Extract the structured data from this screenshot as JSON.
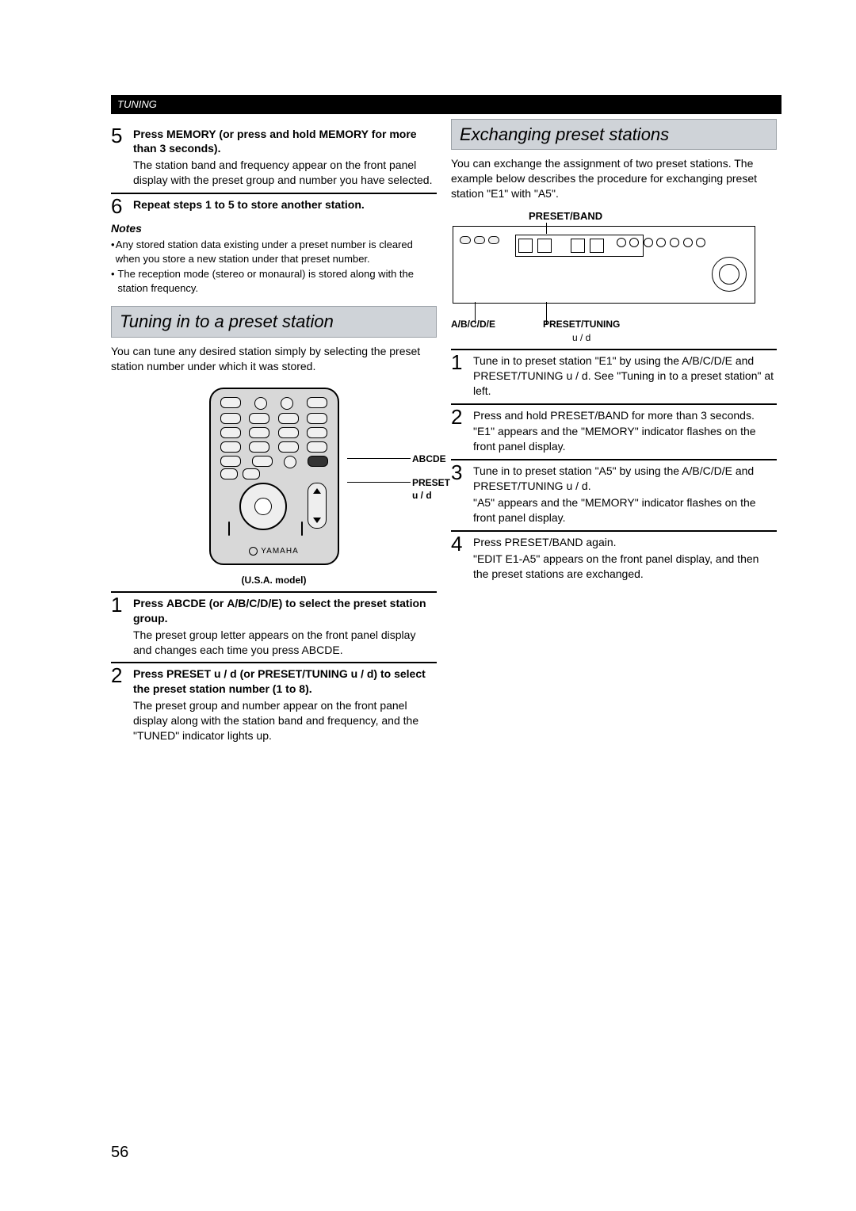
{
  "header_bar": "TUNING",
  "page_number": "56",
  "left": {
    "step5": {
      "num": "5",
      "title_html": "Press <b>MEMORY</b> (or press and hold <b>MEMORY</b> for more than 3 seconds).",
      "expl": "The station band and frequency appear on the front panel display with the preset group and number you have selected."
    },
    "step6": {
      "num": "6",
      "title": "Repeat steps 1 to 5 to store another station."
    },
    "notes_head": "Notes",
    "note1": "Any stored station data existing under a preset number is cleared when you store a new station under that preset number.",
    "note2": "The reception mode (stereo or monaural) is stored along with the station frequency.",
    "tuning_section_title": "Tuning in to a preset station",
    "tuning_intro": "You can tune any desired station simply by selecting the preset station number under which it was stored.",
    "remote": {
      "abcde": "ABCDE",
      "preset": "PRESET u / d",
      "brand": "YAMAHA",
      "usa": "(U.S.A. model)"
    },
    "step1": {
      "num": "1",
      "title_html": "Press <b>ABCDE</b> (or <b>A/B/C/D/E</b>) to select the preset station group.",
      "expl": "The preset group letter appears on the front panel display and changes each time you press ABCDE."
    },
    "step2": {
      "num": "2",
      "title_html": "Press <b>PRESET</b> u / d (or <b>PRESET/TUNING</b> u / d) to select the preset station number (1 to 8).",
      "expl": "The preset group and number appear on the front panel display along with the station band and frequency, and the \"TUNED\" indicator lights up."
    }
  },
  "right": {
    "exchange_title": "Exchanging preset stations",
    "exchange_intro": "You can exchange the assignment of two preset stations. The example below describes the procedure for exchanging preset station \"E1\" with \"A5\".",
    "panel_caption": "PRESET/BAND",
    "panel_label_left": "A/B/C/D/E",
    "panel_label_right_bold": "PRESET/TUNING",
    "panel_label_right_sub": "u / d",
    "rstep1": {
      "num": "1",
      "text": "Tune in to preset station \"E1\" by using the A/B/C/D/E and PRESET/TUNING u / d. See \"Tuning in to a preset station\" at left."
    },
    "rstep2": {
      "num": "2",
      "text": "Press and hold PRESET/BAND for more than 3 seconds.",
      "text2": "\"E1\" appears and the \"MEMORY\" indicator flashes on the front panel display."
    },
    "rstep3": {
      "num": "3",
      "text": "Tune in to preset station \"A5\" by using the A/B/C/D/E and PRESET/TUNING u / d.",
      "text2": "\"A5\" appears and the \"MEMORY\" indicator flashes on the front panel display."
    },
    "rstep4": {
      "num": "4",
      "text": "Press PRESET/BAND again.",
      "text2": "\"EDIT E1-A5\" appears on the front panel display, and then the preset stations are exchanged."
    }
  }
}
